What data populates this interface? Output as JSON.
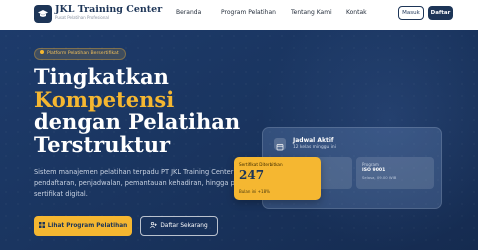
{
  "brand": {
    "name": "JKL Training Center",
    "tagline": "Pusat Pelatihan Profesional"
  },
  "nav": {
    "items": [
      {
        "label": "Beranda"
      },
      {
        "label": "Program Pelatihan"
      },
      {
        "label": "Tentang Kami"
      },
      {
        "label": "Kontak"
      }
    ],
    "login_label": "Masuk",
    "register_label": "Daftar"
  },
  "hero": {
    "badge": "Platform Pelatihan Bersertifikat",
    "headline": {
      "line1": "Tingkatkan",
      "line2": "Kompetensi",
      "line3": "dengan Pelatihan",
      "line4": "Terstruktur"
    },
    "description": "Sistem manajemen pelatihan terpadu PT JKL Training Center — dari pendaftaran, penjadwalan, pemantauan kehadiran, hingga penerbitan sertifikat digital.",
    "primary_button": "Lihat Program Pelatihan",
    "secondary_button": "Daftar Sekarang"
  },
  "schedule_card": {
    "title": "Jadwal Aktif",
    "subtitle": "12 kelas minggu ini",
    "left_label": "",
    "left_value": "",
    "left_sub": "",
    "right_label": "Program",
    "right_value": "ISO 9001",
    "right_sub": "Selasa, 09.00 WIB"
  },
  "certificate_card": {
    "label": "Sertifikat Diterbitkan",
    "value": "247",
    "sub": "Bulan ini +18%"
  },
  "colors": {
    "primary": "#1d3557",
    "accent": "#f5b731",
    "hero_bg": "#1a3560"
  },
  "icons": {
    "logo": "graduation-icon",
    "badge": "dot-icon",
    "primary_button": "grid-icon",
    "secondary_button": "add-user-icon",
    "schedule": "calendar-icon"
  }
}
